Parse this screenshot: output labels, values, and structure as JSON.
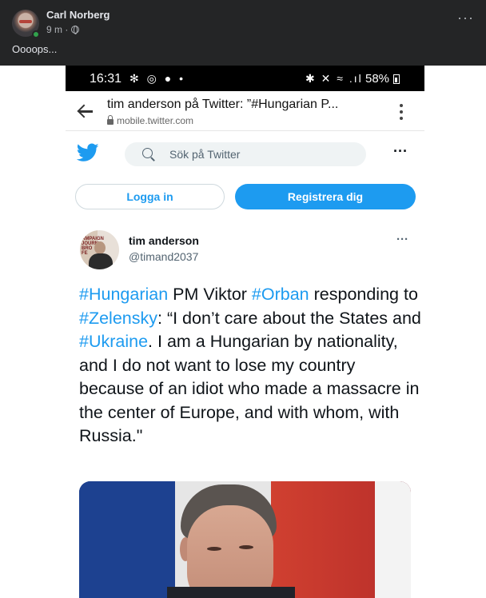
{
  "fb_post": {
    "author": "Carl Norberg",
    "time": "9 m ·",
    "text": "Oooops..."
  },
  "phone_status": {
    "time": "16:31",
    "left_icons": "✻ ◎ ● •",
    "right_icons": "✱ ✕ ≈ .ıl",
    "battery": "58%"
  },
  "browser": {
    "title": "tim anderson på Twitter: ”#Hungarian P...",
    "url": "mobile.twitter.com"
  },
  "twitter": {
    "search_placeholder": "Sök på Twitter",
    "login_label": "Logga in",
    "register_label": "Registrera dig",
    "user_name": "tim anderson",
    "user_handle": "@timand2037",
    "avatar_poster_text": "AMPAIGN\nJOURN\nBRO\nFE",
    "tweet_segments": [
      {
        "text": "#Hungarian",
        "hashtag": true
      },
      {
        "text": " PM Viktor ",
        "hashtag": false
      },
      {
        "text": "#Orban",
        "hashtag": true
      },
      {
        "text": " responding to ",
        "hashtag": false
      },
      {
        "text": "#Zelensky",
        "hashtag": true
      },
      {
        "text": ": “I don’t care about the States and ",
        "hashtag": false
      },
      {
        "text": "#Ukraine",
        "hashtag": true
      },
      {
        "text": ". I am a Hungarian by nationality, and I do not want to lose my country because of an idiot who made a massacre in the center of Europe, and with whom, with Russia.\"",
        "hashtag": false
      }
    ]
  },
  "colors": {
    "twitter_blue": "#1d9bf0",
    "fb_dark": "#242526",
    "online_green": "#31a24c"
  }
}
